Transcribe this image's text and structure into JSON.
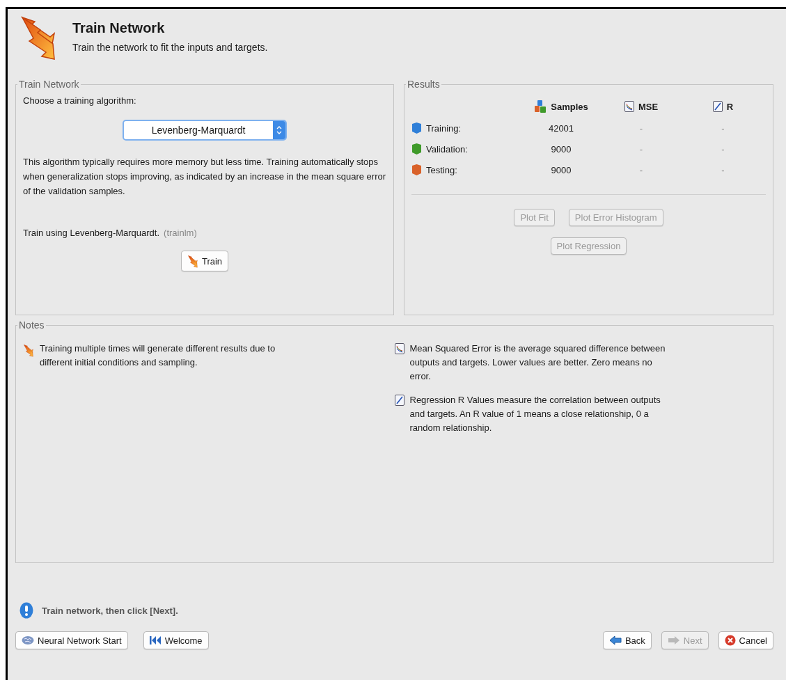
{
  "header": {
    "title": "Train Network",
    "subtitle": "Train the network to fit the inputs and targets."
  },
  "train_panel": {
    "legend": "Train Network",
    "prompt": "Choose a training algorithm:",
    "algorithm": {
      "value": "Levenberg-Marquardt",
      "focused": true
    },
    "description": "This algorithm typically requires more memory but less time. Training automatically stops when generalization stops improving, as indicated by an increase in the mean square error of the validation samples.",
    "using": "Train using Levenberg-Marquardt.",
    "function_name": "(trainlm)",
    "train_button": {
      "label": "Train",
      "disabled": false
    }
  },
  "results": {
    "legend": "Results",
    "columns": [
      {
        "label": "Samples",
        "kind": "samples"
      },
      {
        "label": "MSE",
        "kind": "mse"
      },
      {
        "label": "R",
        "kind": "regression"
      }
    ],
    "rows": [
      {
        "label": "Training:",
        "color": "#2f7fd8",
        "samples": "42001",
        "mse": "-",
        "r": "-"
      },
      {
        "label": "Validation:",
        "color": "#3f9a2a",
        "samples": "9000",
        "mse": "-",
        "r": "-"
      },
      {
        "label": "Testing:",
        "color": "#d9622a",
        "samples": "9000",
        "mse": "-",
        "r": "-"
      }
    ],
    "button_rows": [
      [
        {
          "label": "Plot Fit",
          "disabled": true
        },
        {
          "label": "Plot Error Histogram",
          "disabled": true
        }
      ],
      [
        {
          "label": "Plot Regression",
          "disabled": true
        }
      ]
    ]
  },
  "notes": {
    "legend": "Notes",
    "left": [
      {
        "kind": "train",
        "text": "Training multiple times will generate different results due to different initial conditions and sampling."
      }
    ],
    "right": [
      {
        "kind": "mse",
        "text": "Mean Squared Error is the average squared difference between outputs and targets. Lower values are better. Zero means no error."
      },
      {
        "kind": "regression",
        "text": "Regression R Values measure the correlation between outputs and targets. An R value of 1 means a close relationship, 0 a random relationship."
      }
    ]
  },
  "status": {
    "text": "Train network, then click [Next]."
  },
  "footer": {
    "left": [
      {
        "label": "Neural Network Start",
        "kind": "brain",
        "disabled": false
      },
      {
        "label": "Welcome",
        "kind": "rewind",
        "disabled": false
      }
    ],
    "right": [
      {
        "label": "Back",
        "kind": "back",
        "disabled": false
      },
      {
        "label": "Next",
        "kind": "next",
        "disabled": true
      },
      {
        "label": "Cancel",
        "kind": "cancel",
        "disabled": false
      }
    ]
  }
}
